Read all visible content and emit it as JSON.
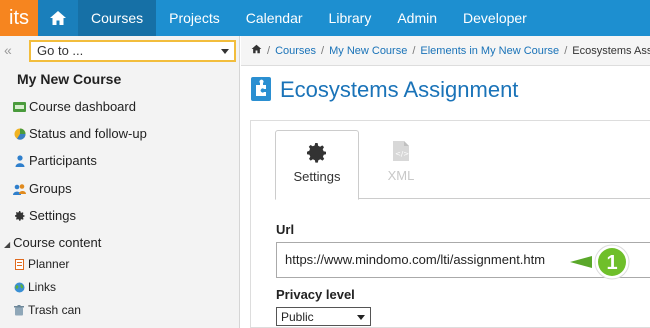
{
  "topnav": {
    "logo": "its",
    "items": [
      {
        "label": "Courses",
        "active": true
      },
      {
        "label": "Projects"
      },
      {
        "label": "Calendar"
      },
      {
        "label": "Library"
      },
      {
        "label": "Admin"
      },
      {
        "label": "Developer"
      }
    ]
  },
  "sidebar": {
    "goto_placeholder": "Go to ...",
    "course_title": "My New Course",
    "items": [
      {
        "label": "Course dashboard",
        "icon": "dashboard-icon"
      },
      {
        "label": "Status and follow-up",
        "icon": "pie-chart-icon"
      },
      {
        "label": "Participants",
        "icon": "person-icon"
      },
      {
        "label": "Groups",
        "icon": "group-icon"
      },
      {
        "label": "Settings",
        "icon": "gear-icon"
      }
    ],
    "section": "Course content",
    "sub_items": [
      {
        "label": "Planner",
        "icon": "planner-icon"
      },
      {
        "label": "Links",
        "icon": "globe-icon"
      },
      {
        "label": "Trash can",
        "icon": "trash-icon"
      }
    ]
  },
  "breadcrumb": {
    "items": [
      "Courses",
      "My New Course",
      "Elements in My New Course"
    ],
    "current": "Ecosystems Assignm"
  },
  "page": {
    "title": "Ecosystems Assignment"
  },
  "tabs": [
    {
      "label": "Settings",
      "icon": "gear-icon",
      "active": true
    },
    {
      "label": "XML",
      "icon": "xml-file-icon",
      "active": false
    }
  ],
  "form": {
    "url_label": "Url",
    "url_value": "https://www.mindomo.com/lti/assignment.htm",
    "privacy_label": "Privacy level",
    "privacy_value": "Public"
  },
  "callout": {
    "number": "1"
  },
  "colors": {
    "nav": "#1d8fd0",
    "logo": "#f6851f",
    "link": "#1a73b8",
    "callout": "#6fbf2a"
  }
}
